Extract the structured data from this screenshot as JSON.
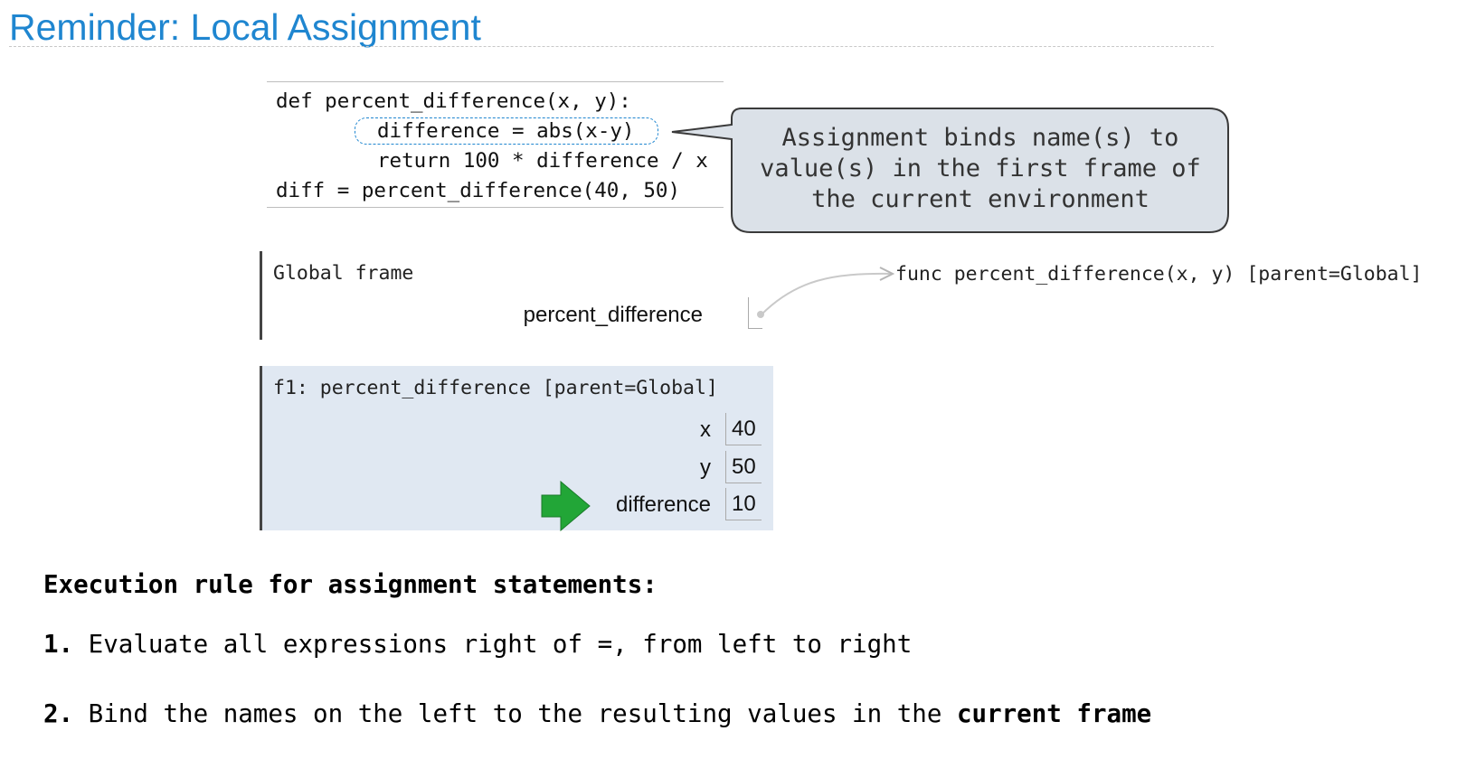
{
  "title": "Reminder: Local Assignment",
  "code": {
    "lines": [
      "def percent_difference(x, y):",
      "difference = abs(x-y)",
      "return 100 * difference / x",
      "diff = percent_difference(40, 50)"
    ]
  },
  "callout": {
    "lines": [
      "Assignment binds name(s) to",
      "value(s) in the first frame of",
      "the current environment"
    ]
  },
  "global_frame": {
    "label": "Global frame",
    "variable": "percent_difference",
    "func_object": "func percent_difference(x, y) [parent=Global]"
  },
  "f1_frame": {
    "label": "f1: percent_difference [parent=Global]",
    "variables": [
      {
        "name": "x",
        "value": "40"
      },
      {
        "name": "y",
        "value": "50"
      },
      {
        "name": "difference",
        "value": "10"
      }
    ]
  },
  "rules": {
    "heading": "Execution rule for assignment statements:",
    "items": [
      {
        "number": "1.",
        "text": " Evaluate all expressions right of =, from left to right",
        "bold": ""
      },
      {
        "number": "2.",
        "text": " Bind the names on the left to the resulting values in the ",
        "bold": "current frame"
      }
    ]
  },
  "colors": {
    "title": "#1f86d0",
    "highlight": "#1f86d0",
    "callout_fill": "#dbe1e8",
    "frame_fill": "#e0e8f2",
    "arrow": "#22a637"
  },
  "icons": {
    "current_line_marker": "green-arrow-icon"
  }
}
